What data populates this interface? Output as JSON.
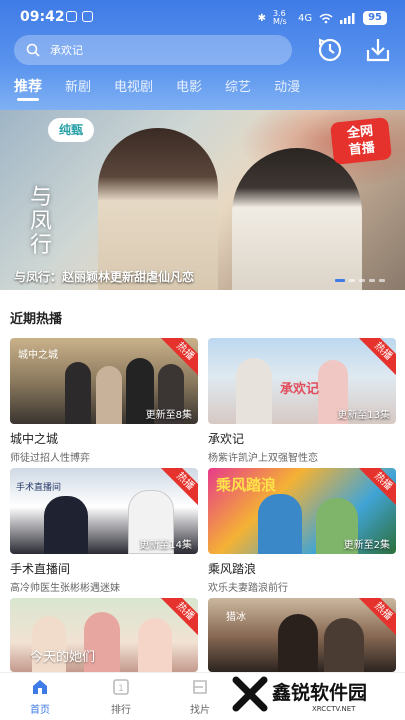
{
  "status": {
    "time": "09:42",
    "net_speed": "3.6 M/s",
    "signal": "4G",
    "battery": "95"
  },
  "search": {
    "placeholder": "承欢记"
  },
  "tabs": [
    "推荐",
    "新剧",
    "电视剧",
    "电影",
    "综艺",
    "动漫"
  ],
  "banner": {
    "caption": "与凤行：赵丽颖林更新甜虐仙凡恋",
    "logo": "纯甄",
    "badge": "全网\n首播",
    "art_title": "与凤行"
  },
  "section": {
    "title": "近期热播"
  },
  "hot_label": "热播",
  "cards": [
    {
      "title": "城中之城",
      "subtitle": "师徒过招人性博弈",
      "update": "更新至8集",
      "art": "城中之城"
    },
    {
      "title": "承欢记",
      "subtitle": "杨紫许凯沪上双强智性恋",
      "update": "更新至13集",
      "art": "承欢记"
    },
    {
      "title": "手术直播间",
      "subtitle": "高冷帅医生张彬彬遇迷妹",
      "update": "更新至14集",
      "art": "手术直播间"
    },
    {
      "title": "乘风踏浪",
      "subtitle": "欢乐夫妻踏浪前行",
      "update": "更新至2集",
      "art": "乘风踏浪"
    },
    {
      "title": "",
      "subtitle": "",
      "update": "",
      "art": "今天的她们"
    },
    {
      "title": "",
      "subtitle": "",
      "update": "",
      "art": "猎冰"
    }
  ],
  "nav": [
    {
      "label": "首页",
      "icon": "home-icon",
      "active": true
    },
    {
      "label": "排行",
      "icon": "rank-icon",
      "active": false
    },
    {
      "label": "找片",
      "icon": "find-icon",
      "active": false
    }
  ],
  "watermark": {
    "text": "鑫锐软件园",
    "url": "XRCCTV.NET"
  },
  "colors": {
    "accent": "#3f7be6",
    "hot": "#e5322c"
  }
}
